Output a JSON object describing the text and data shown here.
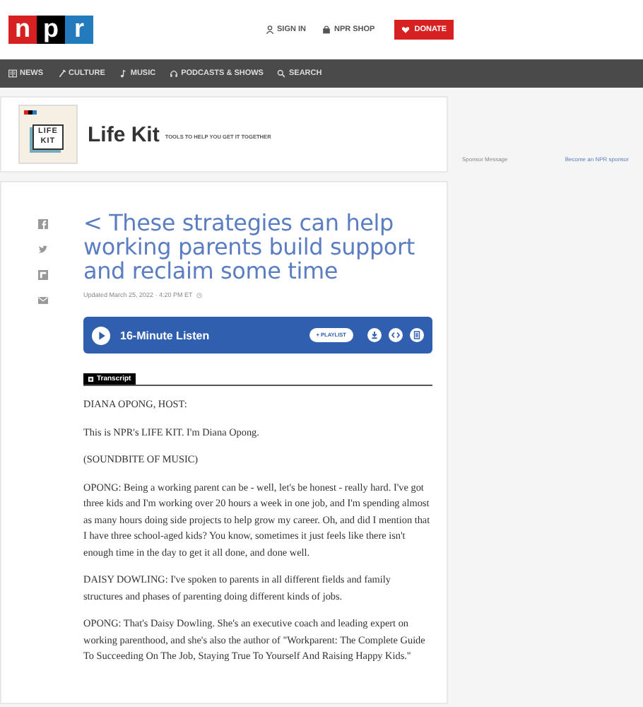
{
  "header": {
    "logo": [
      "n",
      "p",
      "r"
    ],
    "links": [
      {
        "label": "SIGN IN"
      },
      {
        "label": "NPR SHOP"
      }
    ],
    "donate": "DONATE"
  },
  "nav": [
    {
      "label": "NEWS"
    },
    {
      "label": "CULTURE"
    },
    {
      "label": "MUSIC"
    },
    {
      "label": "PODCASTS & SHOWS"
    },
    {
      "label": "SEARCH"
    }
  ],
  "show": {
    "title": "Life Kit",
    "tagline": "TOOLS TO HELP YOU GET IT TOGETHER",
    "art": {
      "lines": [
        "LIFE",
        "KIT"
      ]
    }
  },
  "article": {
    "title": "< These strategies can help working parents build support and reclaim some time",
    "updated": "Updated March 25, 2022 · 4:20 PM ET"
  },
  "player": {
    "label": "16-Minute Listen",
    "playlist": "+ PLAYLIST"
  },
  "transcript": {
    "tab": "Transcript",
    "paragraphs": [
      "DIANA OPONG, HOST:",
      "This is NPR's LIFE KIT. I'm Diana Opong.",
      "(SOUNDBITE OF MUSIC)",
      "OPONG: Being a working parent can be - well, let's be honest - really hard. I've got three kids and I'm working over 20 hours a week in one job, and I'm spending almost as many hours doing side projects to help grow my career. Oh, and did I mention that I have three school-aged kids? You know, sometimes it just feels like there isn't enough time in the day to get it all done, and done well.",
      "DAISY DOWLING: I've spoken to parents in all different fields and family structures and phases of parenting doing different kinds of jobs.",
      "OPONG: That's Daisy Dowling. She's an executive coach and leading expert on working parenthood, and she's also the author of \"Workparent: The Complete Guide To Succeeding On The Job, Staying True To Yourself And Raising Happy Kids.\""
    ]
  },
  "sidebar": {
    "sponsor": "Sponsor Message",
    "link": "Become an NPR sponsor"
  }
}
